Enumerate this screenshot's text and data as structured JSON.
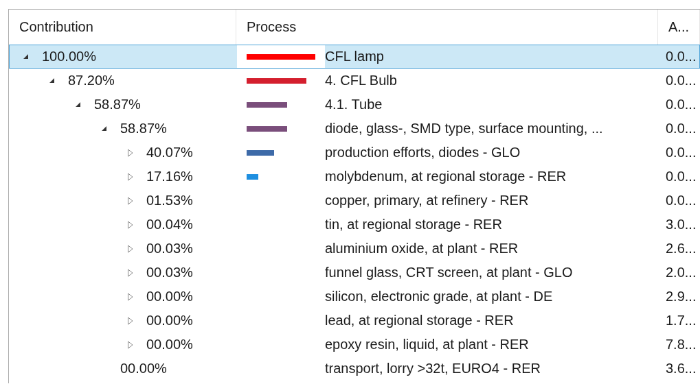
{
  "table": {
    "columns": [
      "Contribution",
      "Process",
      "A..."
    ],
    "rows": [
      {
        "kind": "branch",
        "expanded": true,
        "selected": true,
        "contribution": "100.00%",
        "color": "#ff0000",
        "process": "CFL lamp",
        "column_3": "0.0...",
        "children": [
          {
            "kind": "branch",
            "expanded": true,
            "selected": false,
            "contribution": "87.20%",
            "color": "#d41f2e",
            "process": "4. CFL Bulb",
            "column_3": "0.0...",
            "children": [
              {
                "kind": "branch",
                "expanded": true,
                "selected": false,
                "contribution": "58.87%",
                "color": "#7a4e7b",
                "process": "4.1. Tube",
                "column_3": "0.0...",
                "children": [
                  {
                    "kind": "branch",
                    "expanded": true,
                    "selected": false,
                    "contribution": "58.87%",
                    "color": "#7a4e7b",
                    "process": "diode, glass-, SMD type, surface mounting, ...",
                    "column_3": "0.0...",
                    "children": [
                      {
                        "kind": "branch",
                        "expanded": false,
                        "selected": false,
                        "contribution": "40.07%",
                        "color": "#3d6aa8",
                        "process": "production efforts, diodes - GLO",
                        "column_3": "0.0..."
                      },
                      {
                        "kind": "branch",
                        "expanded": false,
                        "selected": false,
                        "contribution": "17.16%",
                        "color": "#1e8fe0",
                        "process": "molybdenum, at regional storage - RER",
                        "column_3": "0.0..."
                      },
                      {
                        "kind": "branch",
                        "expanded": false,
                        "selected": false,
                        "contribution": "01.53%",
                        "process": "copper, primary, at refinery - RER",
                        "column_3": "0.0..."
                      },
                      {
                        "kind": "branch",
                        "expanded": false,
                        "selected": false,
                        "contribution": "00.04%",
                        "process": "tin, at regional storage - RER",
                        "column_3": "3.0..."
                      },
                      {
                        "kind": "branch",
                        "expanded": false,
                        "selected": false,
                        "contribution": "00.03%",
                        "process": "aluminium oxide, at plant - RER",
                        "column_3": "2.6..."
                      },
                      {
                        "kind": "branch",
                        "expanded": false,
                        "selected": false,
                        "contribution": "00.03%",
                        "process": "funnel glass, CRT screen, at plant - GLO",
                        "column_3": "2.0..."
                      },
                      {
                        "kind": "branch",
                        "expanded": false,
                        "selected": false,
                        "contribution": "00.00%",
                        "process": "silicon, electronic grade, at plant - DE",
                        "column_3": "2.9..."
                      },
                      {
                        "kind": "branch",
                        "expanded": false,
                        "selected": false,
                        "contribution": "00.00%",
                        "process": "lead, at regional storage - RER",
                        "column_3": "1.7..."
                      },
                      {
                        "kind": "branch",
                        "expanded": false,
                        "selected": false,
                        "contribution": "00.00%",
                        "process": "epoxy resin, liquid, at plant - RER",
                        "column_3": "7.8..."
                      }
                    ]
                  },
                  {
                    "kind": "leaf",
                    "selected": false,
                    "contribution": "00.00%",
                    "process": "transport, lorry >32t, EURO4 - RER",
                    "column_3": "3.6..."
                  }
                ]
              }
            ]
          }
        ]
      }
    ]
  }
}
